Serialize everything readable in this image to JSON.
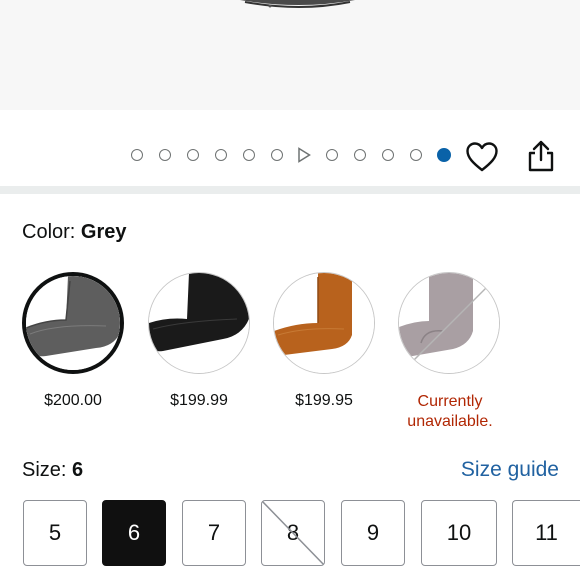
{
  "gallery": {
    "dot_count": 11,
    "active_index": 10,
    "video_index": 6,
    "active_color": "#0a62a8"
  },
  "actions": {
    "wishlist_icon": "heart-icon",
    "share_icon": "share-icon"
  },
  "color": {
    "label": "Color:",
    "selected": "Grey",
    "swatches": [
      {
        "name": "Grey",
        "price": "$200.00",
        "available": true,
        "selected": true
      },
      {
        "name": "Black",
        "price": "$199.99",
        "available": true,
        "selected": false
      },
      {
        "name": "Chestnut",
        "price": "$199.95",
        "available": true,
        "selected": false
      },
      {
        "name": "Light Grey",
        "status": "Currently unavailable.",
        "available": false,
        "selected": false
      }
    ]
  },
  "size": {
    "label": "Size:",
    "selected": "6",
    "guide_link": "Size guide",
    "options": [
      {
        "value": "5",
        "available": true
      },
      {
        "value": "6",
        "available": true,
        "selected": true
      },
      {
        "value": "7",
        "available": true
      },
      {
        "value": "8",
        "available": false
      },
      {
        "value": "9",
        "available": true
      },
      {
        "value": "10",
        "available": true
      },
      {
        "value": "11",
        "available": true
      }
    ]
  },
  "colors": {
    "unavailable_text": "#b12704",
    "link": "#2162a1",
    "selected_size_bg": "#101010"
  }
}
